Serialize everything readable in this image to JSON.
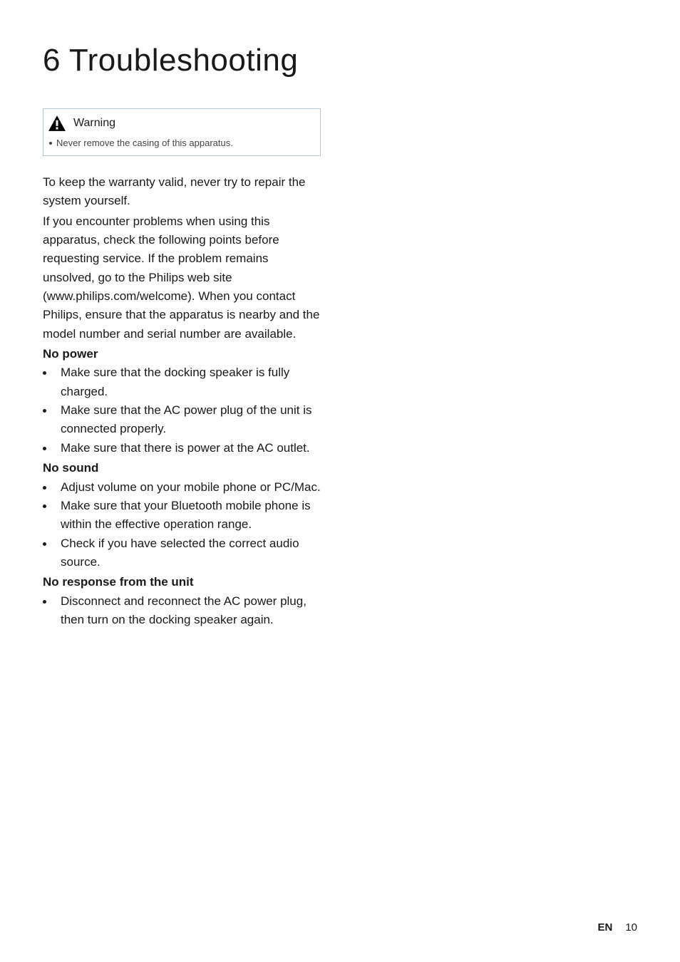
{
  "heading": "6   Troubleshooting",
  "warning": {
    "title": "Warning",
    "items": [
      "Never remove the casing of this apparatus."
    ]
  },
  "intro1": "To keep the warranty valid, never try to repair the system yourself.",
  "intro2": "If you encounter problems when using this apparatus, check the following points before requesting service. If the problem remains unsolved, go to the Philips web site (www.philips.com/welcome). When you contact Philips, ensure that the apparatus is nearby and the model number and serial number are available.",
  "sections": [
    {
      "heading": "No power",
      "items": [
        "Make sure that the docking speaker is fully charged.",
        "Make sure that the AC power plug of the unit is connected properly.",
        "Make sure that there is power at the AC outlet."
      ]
    },
    {
      "heading": "No sound",
      "items": [
        "Adjust volume on your mobile phone or PC/Mac.",
        "Make sure that your Bluetooth mobile phone is within the effective operation range.",
        "Check if you have selected the correct audio source."
      ]
    },
    {
      "heading": "No response from the unit",
      "items": [
        "Disconnect and reconnect the AC power plug, then turn on the docking speaker again."
      ]
    }
  ],
  "footer": {
    "lang": "EN",
    "page": "10"
  }
}
